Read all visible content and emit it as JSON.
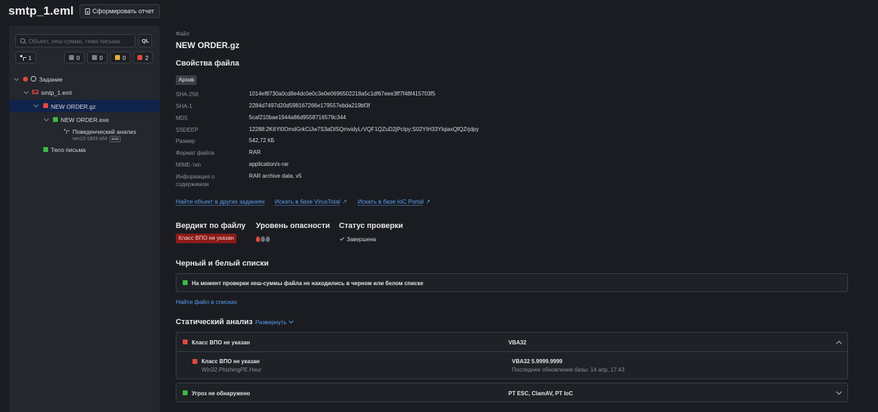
{
  "header": {
    "title": "smtp_1.eml",
    "report_button": "Сформировать отчет"
  },
  "sidebar": {
    "search_placeholder": "Объект, хеш-сумма, тема письма",
    "ql_label": "QL",
    "counters": [
      {
        "icon": "tree-icon",
        "value": "1"
      },
      {
        "icon": "gray-square-icon",
        "value": "0",
        "color": "#7d828b"
      },
      {
        "icon": "file-square-icon",
        "value": "0",
        "color": "#7d828b"
      },
      {
        "icon": "yellow-square-icon",
        "value": "0",
        "color": "#e6b035"
      },
      {
        "icon": "red-square-icon",
        "value": "2",
        "color": "#e0493d"
      }
    ],
    "tree": [
      {
        "label": "Задание"
      },
      {
        "label": "smtp_1.eml"
      },
      {
        "label": "NEW ORDER.gz"
      },
      {
        "label": "NEW ORDER.exe"
      },
      {
        "label": "Поведенческий анализ",
        "sub": "win10-1803-x64",
        "tag": "exe"
      },
      {
        "label": "Тело письма"
      }
    ]
  },
  "file": {
    "label": "Файл",
    "name": "NEW ORDER.gz",
    "properties_title": "Свойства файла",
    "archive_badge": "Архив",
    "props": [
      {
        "key": "SHA-256",
        "value": "1014ef8730a0cd8e4dc0e0c3e0e0696502218a5c1df67eee3ff7f48f415703f5"
      },
      {
        "key": "SHA-1",
        "value": "2284d7497d20d598167266e179557ebda219bf3f"
      },
      {
        "key": "MD5",
        "value": "5caf210bae1944a86d9558716579c344"
      },
      {
        "key": "SSDEEP",
        "value": "12288:2K6Yl0OmdGrkCiJw7S3aDlSQmvidyLrVQF1QZuD2jPcIpy:S02YIH33YlqiaxQfQZrjdpy"
      },
      {
        "key": "Размер",
        "value": "542,72 КБ"
      },
      {
        "key": "Формат файла",
        "value": "RAR"
      },
      {
        "key": "MIME-тип",
        "value": "application/x-rar"
      },
      {
        "key": "Информация о содержимом",
        "value": "RAR archive data, v5"
      }
    ],
    "links": {
      "other_tasks": "Найти объект в других заданиях",
      "virustotal": "Искать в базе VirusTotal",
      "ioc_portal": "Искать в базе IoC Portal"
    }
  },
  "verdict": {
    "title": "Вердикт по файлу",
    "value": "Класс ВПО не указан",
    "danger_title": "Уровень опасности",
    "danger_level": 1,
    "danger_max": 3,
    "status_title": "Статус проверки",
    "status_value": "Завершена"
  },
  "lists": {
    "title": "Черный и белый списки",
    "message": "На момент проверки хеш-суммы файла не находились в черном или белом списке",
    "link": "Найти файл в списках"
  },
  "static": {
    "title": "Статический анализ",
    "expand": "Развернуть",
    "group1": {
      "label": "Класс ВПО не указан",
      "engine": "VBA32",
      "detail_label": "Класс ВПО не указан",
      "detail_sub": "Win32.PhishingPE.Heur",
      "detail_engine": "VBA32 5.9999.9999",
      "detail_update": "Последнее обновление базы: 14 апр, 17:43"
    },
    "group2": {
      "label": "Угроз не обнаружено",
      "engines": "PT ESC, ClamAV, PT IoC"
    }
  },
  "colors": {
    "red": "#e0493d",
    "green": "#3dbb45",
    "link": "#5aa0f2",
    "verdict_bg": "#8b1a17"
  }
}
